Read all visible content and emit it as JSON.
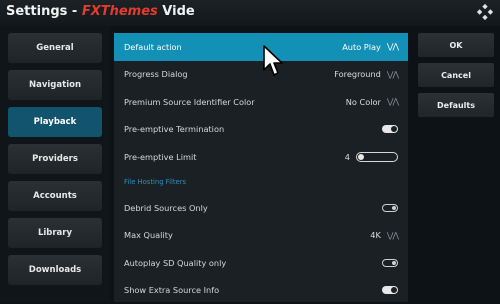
{
  "header": {
    "title_prefix": "Settings - ",
    "addon_name": "FXThemes",
    "title_suffix": " Vide",
    "logo_icon": "kodi-logo-icon"
  },
  "nav": {
    "items": [
      {
        "label": "General"
      },
      {
        "label": "Navigation"
      },
      {
        "label": "Playback",
        "active": true
      },
      {
        "label": "Providers"
      },
      {
        "label": "Accounts"
      },
      {
        "label": "Library"
      },
      {
        "label": "Downloads"
      }
    ]
  },
  "settings": {
    "rows": [
      {
        "label": "Default action",
        "value": "Auto Play",
        "control": "spinner"
      },
      {
        "label": "Progress Dialog",
        "value": "Foreground",
        "control": "spinner"
      },
      {
        "label": "Premium Source Identifier Color",
        "value": "No Color",
        "control": "spinner"
      },
      {
        "label": "Pre-emptive Termination",
        "control": "toggle",
        "state": true
      },
      {
        "label": "Pre-emptive Limit",
        "value": "4",
        "control": "slider"
      },
      {
        "label": "Debrid Sources Only",
        "control": "toggle",
        "state": false
      },
      {
        "label": "Max Quality",
        "value": "4K",
        "control": "spinner"
      },
      {
        "label": "Autoplay SD Quality only",
        "control": "toggle",
        "state": false
      },
      {
        "label": "Show Extra Source Info",
        "control": "toggle",
        "state": true
      }
    ],
    "section_label": "File Hosting Filters",
    "chevrons": "⋁⋀"
  },
  "buttons": {
    "ok": "OK",
    "cancel": "Cancel",
    "defaults": "Defaults"
  },
  "colors": {
    "selected_row": "#1290b6",
    "active_nav": "#12546e",
    "section_header": "#2e8fbf",
    "addon_name": "#e33b2e"
  }
}
